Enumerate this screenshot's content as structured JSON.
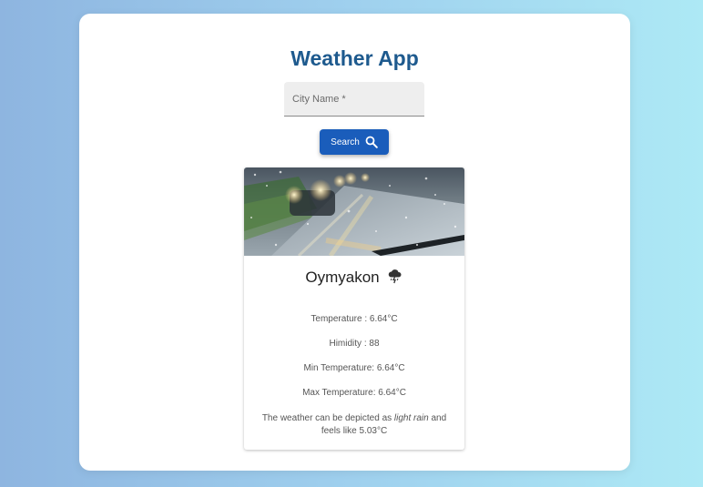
{
  "app": {
    "title": "Weather App"
  },
  "search": {
    "placeholder": "City Name *",
    "value": "",
    "button_label": "Search",
    "button_icon": "search-icon"
  },
  "weather_card": {
    "city": "Oymyakon",
    "condition_icon": "thunderstorm-cloud-icon",
    "temperature_label": "Temperature : ",
    "temperature_value": "6.64°C",
    "humidity_label": "Himidity : ",
    "humidity_value": "88",
    "min_label": "Min Temperature: ",
    "min_value": "6.64°C",
    "max_label": "Max Temperature: ",
    "max_value": "6.64°C",
    "desc_prefix": "The weather can be depicted as ",
    "desc_condition": "light rain",
    "desc_middle": " and feels like ",
    "desc_feels_like": "5.03°C"
  },
  "colors": {
    "title": "#1e5a8e",
    "button": "#1a5dbb",
    "background_left": "#8eb5e0",
    "background_right": "#ade9f5"
  }
}
